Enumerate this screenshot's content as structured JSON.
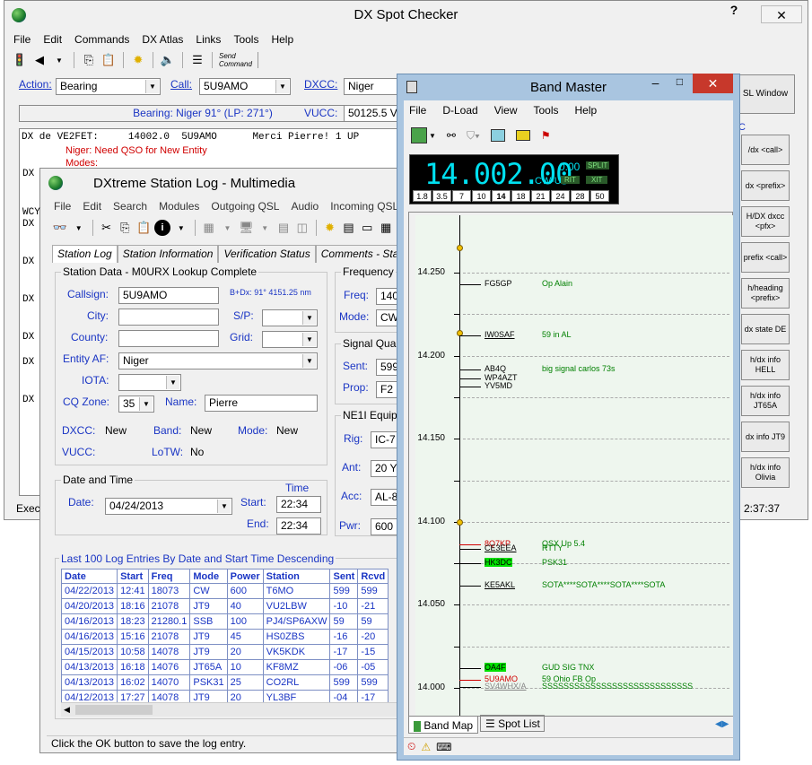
{
  "dx": {
    "title": "DX Spot Checker",
    "menu": [
      "File",
      "Edit",
      "Commands",
      "DX Atlas",
      "Links",
      "Tools",
      "Help"
    ],
    "send_command": "Send\nCommand",
    "action_label": "Action:",
    "action_value": "Bearing",
    "call_label": "Call:",
    "call_value": "5U9AMO",
    "dxcc_label": "DXCC:",
    "dxcc_value": "Niger",
    "vucc_label": "VUCC:",
    "vucc_value": "50125.5 V",
    "bearing": "Bearing: Niger 91° (LP: 271°)",
    "sel_window": "SL Window",
    "spot_line": "DX de VE2FET:     14002.0  5U9AMO      Merci Pierre! 1 UP",
    "need1": "Niger: Need QSO for New Entity",
    "need2": "Modes:",
    "prefixes": [
      "DX",
      "WCY",
      "DX",
      "DX",
      "DX",
      "DX",
      "DX",
      "DX"
    ],
    "exec": "Exec",
    "clock": "2:37:37",
    "rbuttons": [
      "/dx <call>",
      "dx <prefix>",
      "H/DX dxcc <pfx>",
      "prefix <call>",
      "h/heading <prefix>",
      "dx state DE",
      "h/dx info HELL",
      "h/dx info JT65A",
      "dx info JT9",
      "h/dx info Olivia"
    ]
  },
  "log": {
    "title": "DXtreme Station Log - Multimedia",
    "menu": [
      "File",
      "Edit",
      "Search",
      "Modules",
      "Outgoing QSL",
      "Audio",
      "Incoming QSL"
    ],
    "tabs": [
      "Station Log",
      "Station Information",
      "Verification Status",
      "Comments - Station"
    ],
    "station_group": "Station Data - M0URX Lookup Complete",
    "callsign_label": "Callsign:",
    "callsign": "5U9AMO",
    "bdx": "B+Dx: 91° 4151.25 nm",
    "city_label": "City:",
    "sp_label": "S/P:",
    "county_label": "County:",
    "grid_label": "Grid:",
    "entity_label": "Entity AF:",
    "entity": "Niger",
    "iota_label": "IOTA:",
    "cq_label": "CQ Zone:",
    "cq": "35",
    "name_label": "Name:",
    "name": "Pierre",
    "dxcc_label": "DXCC:",
    "dxcc": "New",
    "band_label": "Band:",
    "band": "New",
    "mode_label": "Mode:",
    "mode": "New",
    "vucc_label": "VUCC:",
    "lotw_label": "LoTW:",
    "lotw": "No",
    "freq_group": "Frequency",
    "freq_label": "Freq:",
    "freq": "140",
    "fmode_label": "Mode:",
    "fmode": "CW",
    "signal_group": "Signal Qua",
    "sent_label": "Sent:",
    "sent": "599",
    "prop_label": "Prop:",
    "prop": "F2",
    "equip_group": "NE1I Equip",
    "rig_label": "Rig:",
    "rig": "IC-7",
    "ant_label": "Ant:",
    "ant": "20 Y",
    "acc_label": "Acc:",
    "acc": "AL-8",
    "pwr_label": "Pwr:",
    "pwr": "600",
    "dt_group": "Date and Time",
    "time_label": "Time",
    "date_label": "Date:",
    "date": "04/24/2013",
    "start_label": "Start:",
    "start": "22:34",
    "end_label": "End:",
    "end": "22:34",
    "list_title": "Last 100 Log Entries By Date and Start Time Descending",
    "columns": [
      "Date",
      "Start",
      "Freq",
      "Mode",
      "Power",
      "Station",
      "Sent",
      "Rcvd"
    ],
    "rows": [
      [
        "04/22/2013",
        "12:41",
        "18073",
        "CW",
        "600",
        "T6MO",
        "599",
        "599"
      ],
      [
        "04/20/2013",
        "18:16",
        "21078",
        "JT9",
        "40",
        "VU2LBW",
        "-10",
        "-21"
      ],
      [
        "04/16/2013",
        "18:23",
        "21280.1",
        "SSB",
        "100",
        "PJ4/SP6AXW",
        "59",
        "59"
      ],
      [
        "04/16/2013",
        "15:16",
        "21078",
        "JT9",
        "45",
        "HS0ZBS",
        "-16",
        "-20"
      ],
      [
        "04/15/2013",
        "10:58",
        "14078",
        "JT9",
        "20",
        "VK5KDK",
        "-17",
        "-15"
      ],
      [
        "04/13/2013",
        "16:18",
        "14076",
        "JT65A",
        "10",
        "KF8MZ",
        "-06",
        "-05"
      ],
      [
        "04/13/2013",
        "16:02",
        "14070",
        "PSK31",
        "25",
        "CO2RL",
        "599",
        "599"
      ],
      [
        "04/12/2013",
        "17:27",
        "14078",
        "JT9",
        "20",
        "YL3BF",
        "-04",
        "-17"
      ]
    ],
    "status": "Click the OK button to save the log entry."
  },
  "bm": {
    "title": "Band Master",
    "menu": [
      "File",
      "D-Load",
      "View",
      "Tools",
      "Help"
    ],
    "freq": "14.002.00",
    "sub": "0.00",
    "mode": "CW-U",
    "split": "SPLIT",
    "rit": "RIT",
    "xit": "XIT",
    "bands": [
      "1.8",
      "3.5",
      "7",
      "10",
      "14",
      "18",
      "21",
      "24",
      "28",
      "50"
    ],
    "scale": [
      "14.250",
      "14.200",
      "14.150",
      "14.100",
      "14.050",
      "14.000"
    ],
    "spots": [
      {
        "call": "FG5GP",
        "cmt": "Op Alain",
        "color": "#000"
      },
      {
        "call": "IW0SAF",
        "cmt": "59 in AL",
        "color": "#000"
      },
      {
        "call": "AB4Q",
        "cmt": "big signal carlos 73s",
        "color": "#000"
      },
      {
        "call": "WP4AZT",
        "cmt": "",
        "color": "#000"
      },
      {
        "call": "YV5MD",
        "cmt": "",
        "color": "#000"
      },
      {
        "call": "8Q7KP",
        "cmt": "QSX Up 5.4",
        "color": "#d00000"
      },
      {
        "call": "CE3EEA",
        "cmt": "RTTY",
        "color": "#000"
      },
      {
        "call": "HK3DC",
        "cmt": "PSK31",
        "color": "#000"
      },
      {
        "call": "KE5AKL",
        "cmt": "SOTA****SOTA****SOTA****SOTA",
        "color": "#000"
      },
      {
        "call": "OA4F",
        "cmt": "GUD SIG TNX",
        "color": "#000"
      },
      {
        "call": "5U9AMO",
        "cmt": "59 Ohio FB Op",
        "color": "#d00000"
      },
      {
        "call": "SV4WHX/A",
        "cmt": "SSSSSSSSSSSSSSSSSSSSSSSSSSSS",
        "color": "#888"
      }
    ],
    "tabs": [
      "Band Map",
      "Spot List"
    ]
  }
}
